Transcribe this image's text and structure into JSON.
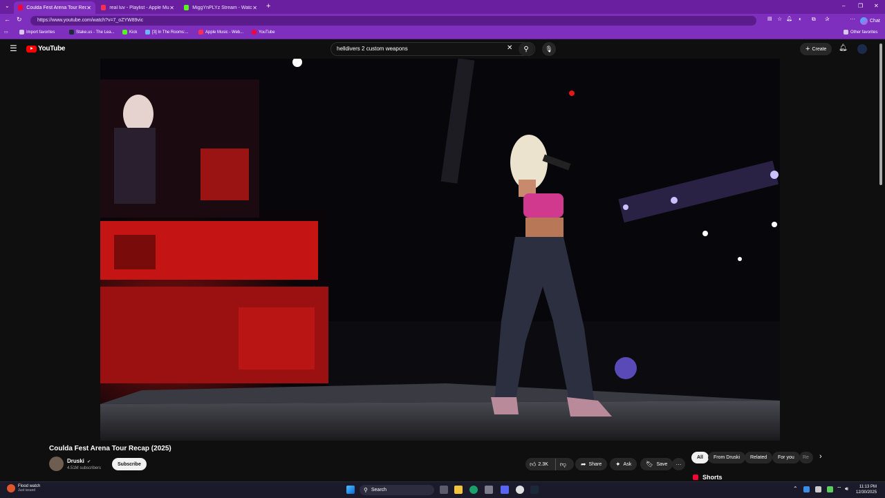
{
  "browser": {
    "tabs": [
      {
        "title": "Coulda Fest Arena Tour Recap",
        "active": true
      },
      {
        "title": "real luv - Playlist - Apple Music",
        "active": false
      },
      {
        "title": "MiggYnPLYz Stream - Watch L",
        "active": false
      }
    ],
    "url": "https://www.youtube.com/watch?v=7_oZYW89vic",
    "chat_label": "Chat",
    "bookmarks": [
      "Import favorites",
      "Stake.us - The Lea...",
      "Kick",
      "[3] In The Rooms:...",
      "Apple Music - Web...",
      "YouTube"
    ],
    "other_favorites": "Other favorites"
  },
  "youtube": {
    "logo_text": "YouTube",
    "search_value": "helldivers 2 custom weapons",
    "create_label": "Create"
  },
  "video": {
    "title": "Coulda Fest Arena Tour Recap (2025)",
    "channel": "Druski",
    "subscribers": "4.51M subscribers",
    "subscribe_label": "Subscribe",
    "like_count": "2.3K",
    "share_label": "Share",
    "ask_label": "Ask",
    "save_label": "Save"
  },
  "chips": [
    "All",
    "From Druski",
    "Related",
    "For you",
    "Re"
  ],
  "shorts_label": "Shorts",
  "taskbar": {
    "weather_title": "Flood watch",
    "weather_sub": "Just issued",
    "search_label": "Search",
    "time": "11:13 PM",
    "date": "12/30/2025"
  },
  "colors": {
    "browser_purple": "#7e2fbe",
    "youtube_red": "#ff0000",
    "bg": "#0f0f0f"
  }
}
